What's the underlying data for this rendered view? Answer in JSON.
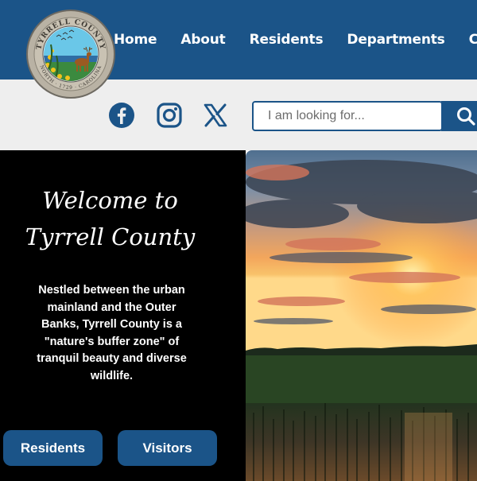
{
  "header": {
    "nav": [
      {
        "label": "Home"
      },
      {
        "label": "About"
      },
      {
        "label": "Residents"
      },
      {
        "label": "Departments"
      },
      {
        "label": "Con"
      }
    ],
    "seal": {
      "top_text": "TYRRELL COUNTY",
      "bottom_text": "NORTH · 1729 · CAROLINA"
    }
  },
  "utility": {
    "social": [
      {
        "icon": "facebook-icon"
      },
      {
        "icon": "instagram-icon"
      },
      {
        "icon": "x-icon"
      }
    ],
    "search": {
      "placeholder": "I am looking for...",
      "button_icon": "search-icon"
    }
  },
  "hero": {
    "title_line1": "Welcome to",
    "title_line2": "Tyrrell County",
    "text_lines": [
      "Nestled between the urban",
      "mainland and the Outer",
      "Banks, Tyrrell County is a",
      "\"nature's buffer zone\" of",
      "tranquil beauty and diverse",
      "wildlife."
    ],
    "buttons": {
      "residents": "Residents",
      "visitors": "Visitors"
    }
  },
  "colors": {
    "brand_blue": "#1b5488",
    "utility_bg": "#eeeeee",
    "hero_bg": "#000000"
  }
}
